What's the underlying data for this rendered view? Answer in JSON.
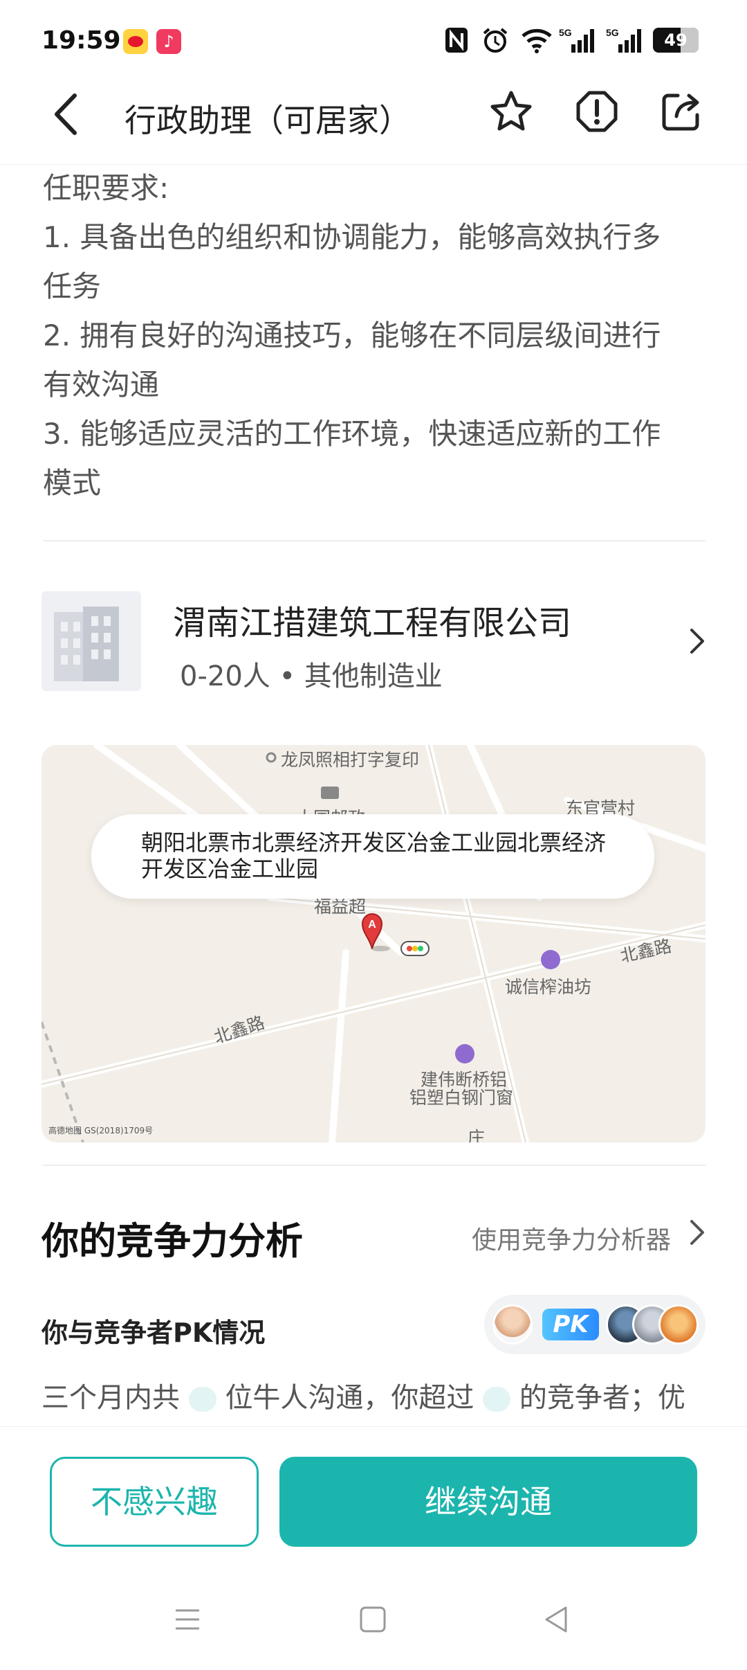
{
  "status_bar": {
    "time": "19:59",
    "network_1": "5G",
    "network_2": "5G",
    "battery": "49"
  },
  "header": {
    "title": "行政助理（可居家）"
  },
  "requirements": {
    "heading": "任职要求:",
    "items": [
      "1. 具备出色的组织和协调能力，能够高效执行多",
      "任务",
      "2. 拥有良好的沟通技巧，能够在不同层级间进行",
      "有效沟通",
      "3. 能够适应灵活的工作环境，快速适应新的工作",
      "模式"
    ]
  },
  "company": {
    "name": "渭南江措建筑工程有限公司",
    "meta": "0-20人 • 其他制造业"
  },
  "map": {
    "address": "朝阳北票市北票经济开发区冶金工业园北票经济开发区冶金工业园",
    "labels": {
      "print_shop": "龙凤照相打字复印",
      "post": "大国邮政",
      "village": "东官营村",
      "shop": "福益超",
      "oil": "诚信榨油坊",
      "road1": "北鑫路",
      "road2": "北鑫路",
      "window_1": "建伟断桥铝",
      "window_2": "铝塑白钢门窗",
      "zhuang": "庄"
    },
    "pin_label": "A",
    "attribution": "高德地图 GS(2018)1709号"
  },
  "competition": {
    "title": "你的竞争力分析",
    "link_label": "使用竞争力分析器",
    "pk_label": "你与竞争者PK情况",
    "pk_badge": "PK",
    "summary_a": "三个月内共",
    "summary_b": "位牛人沟通，你超过",
    "summary_c": "的竞争者；优"
  },
  "actions": {
    "not_interested": "不感兴趣",
    "continue_chat": "继续沟通"
  },
  "colors": {
    "accent": "#1cb5ad",
    "map_bg": "#f3efe8"
  }
}
